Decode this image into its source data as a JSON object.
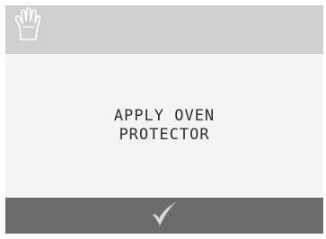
{
  "message": {
    "line1": "APPLY OVEN",
    "line2": "PROTECTOR"
  },
  "icons": {
    "header": "oven-mitt-hand-icon",
    "confirm": "checkmark-icon"
  },
  "colors": {
    "header_bg": "#cfcfcf",
    "content_bg": "#f4f4f4",
    "footer_bg": "#6b6b6b",
    "text": "#2e2e2e"
  }
}
